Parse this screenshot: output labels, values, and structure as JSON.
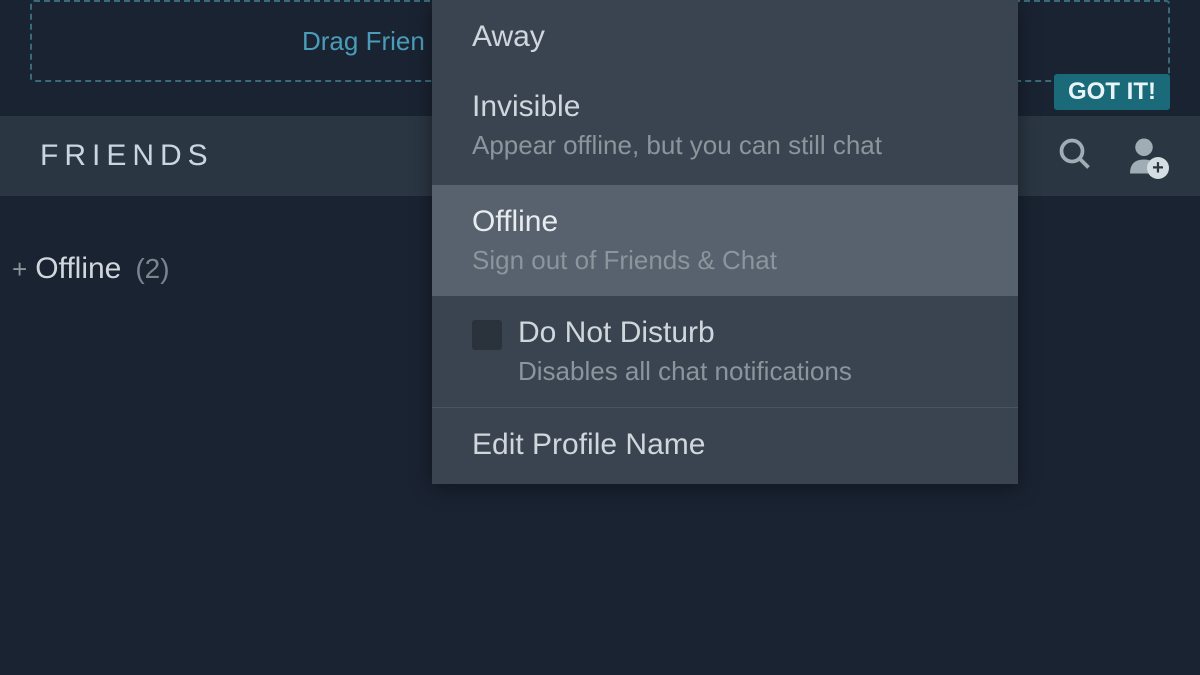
{
  "dropZone": {
    "text": "Drag Frien"
  },
  "gotItButton": {
    "label": "GOT IT!"
  },
  "friendsHeader": {
    "title": "FRIENDS"
  },
  "offlineStatus": {
    "plusSymbol": "+",
    "label": "Offline",
    "count": "(2)"
  },
  "statusMenu": {
    "away": {
      "title": "Away"
    },
    "invisible": {
      "title": "Invisible",
      "subtitle": "Appear offline, but you can still chat"
    },
    "offline": {
      "title": "Offline",
      "subtitle": "Sign out of Friends & Chat"
    },
    "dnd": {
      "title": "Do Not Disturb",
      "subtitle": "Disables all chat notifications"
    },
    "editProfile": {
      "title": "Edit Profile Name"
    }
  }
}
